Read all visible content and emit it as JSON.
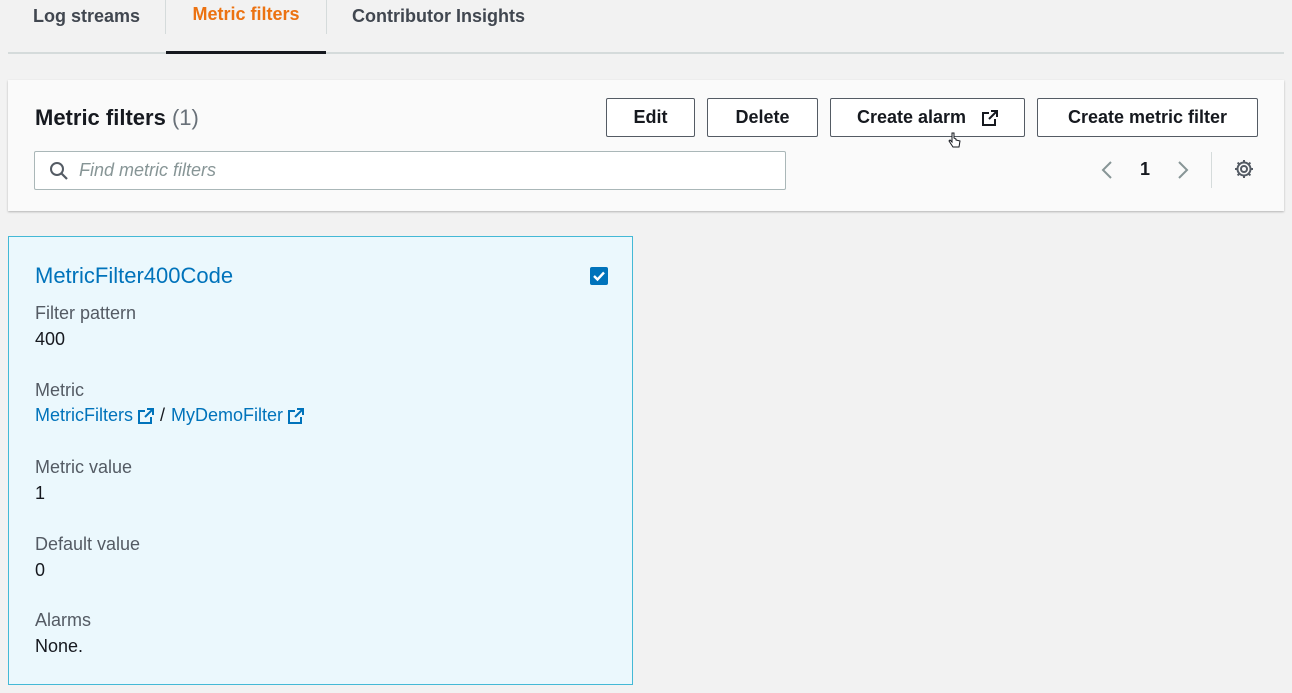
{
  "tabs": [
    {
      "label": "Log streams"
    },
    {
      "label": "Metric filters"
    },
    {
      "label": "Contributor Insights"
    }
  ],
  "active_tab_color": "#ec7211",
  "header": {
    "title": "Metric filters",
    "count": "(1)"
  },
  "toolbar": {
    "edit_label": "Edit",
    "delete_label": "Delete",
    "create_alarm_label": "Create alarm",
    "create_metric_filter_label": "Create metric filter"
  },
  "search": {
    "placeholder": "Find metric filters",
    "value": ""
  },
  "pagination": {
    "current_page": "1"
  },
  "card": {
    "title": "MetricFilter400Code",
    "selected": true,
    "filter_pattern_label": "Filter pattern",
    "filter_pattern_value": "400",
    "metric_label": "Metric",
    "metric_namespace": "MetricFilters",
    "metric_separator": "/",
    "metric_name": "MyDemoFilter",
    "metric_value_label": "Metric value",
    "metric_value": "1",
    "default_value_label": "Default value",
    "default_value": "0",
    "alarms_label": "Alarms",
    "alarms_value": "None."
  },
  "icons": {
    "search": "search-icon",
    "external_link": "external-link-icon",
    "prev": "chevron-left-icon",
    "next": "chevron-right-icon",
    "settings": "gear-icon",
    "checkbox": "checkbox-checked-icon"
  },
  "colors": {
    "link": "#0073bb",
    "card_background": "#ebf8fd",
    "card_border": "#44b9d6"
  }
}
